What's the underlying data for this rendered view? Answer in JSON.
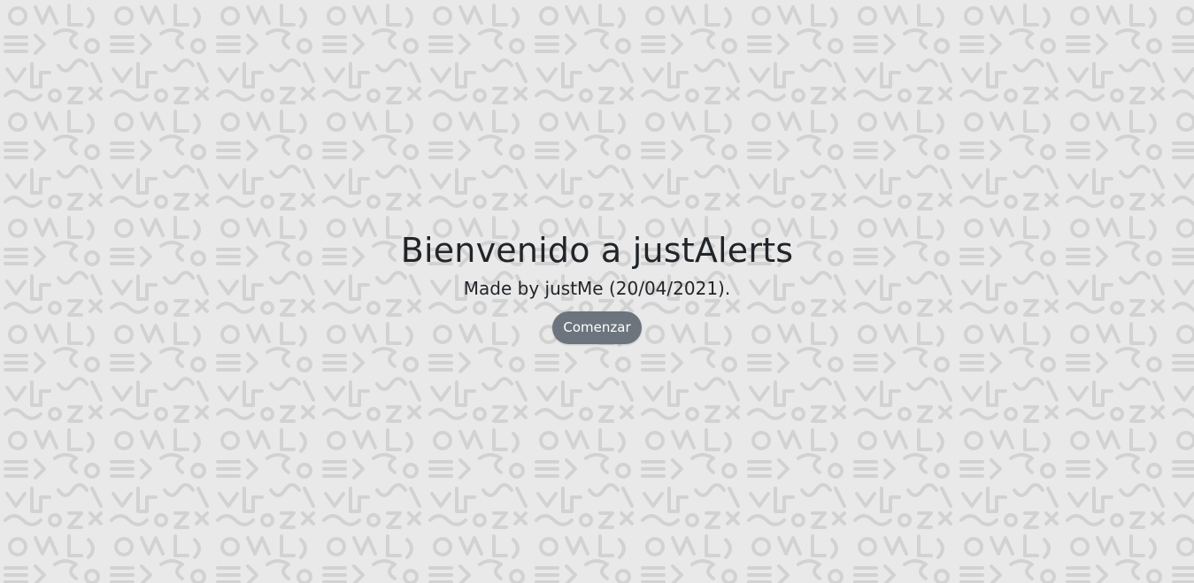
{
  "theme": {
    "background": "#e9e9e9",
    "pattern_color": "#d2d2d2",
    "button_color": "#6c757d",
    "text_color": "#212529"
  },
  "hero": {
    "title": "Bienvenido a justAlerts",
    "subtitle": "Made by justMe (20/04/2021).",
    "start_button_label": "Comenzar"
  }
}
